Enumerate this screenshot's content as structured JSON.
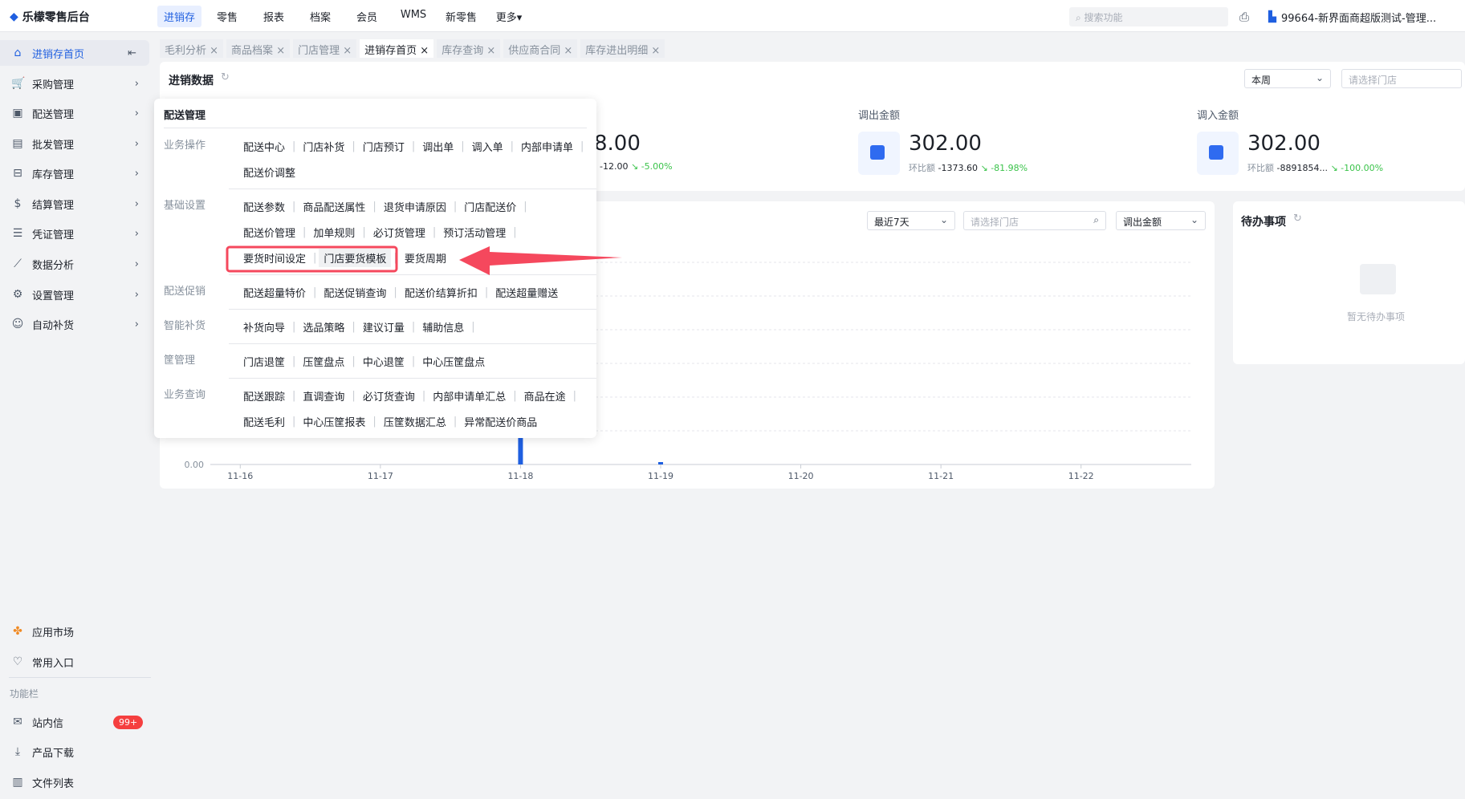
{
  "app": {
    "title": "乐檬零售后台"
  },
  "topnav": {
    "items": [
      "进销存",
      "零售",
      "报表",
      "档案",
      "会员",
      "WMS",
      "新零售",
      "更多▾"
    ],
    "active": 0,
    "search_placeholder": "搜索功能",
    "user": "99664-新界面商超版测试-管理..."
  },
  "sidebar": {
    "items": [
      {
        "label": "进销存首页",
        "icon": "home-icon"
      },
      {
        "label": "采购管理",
        "icon": "cart-icon"
      },
      {
        "label": "配送管理",
        "icon": "box-icon"
      },
      {
        "label": "批发管理",
        "icon": "storage-icon"
      },
      {
        "label": "库存管理",
        "icon": "inventory-icon"
      },
      {
        "label": "结算管理",
        "icon": "dollar-icon"
      },
      {
        "label": "凭证管理",
        "icon": "document-icon"
      },
      {
        "label": "数据分析",
        "icon": "chart-icon"
      },
      {
        "label": "设置管理",
        "icon": "gear-icon"
      },
      {
        "label": "自动补货",
        "icon": "robot-icon"
      }
    ],
    "bottom": [
      {
        "label": "应用市场",
        "icon": "app-market-icon"
      },
      {
        "label": "常用入口",
        "icon": "heart-icon"
      }
    ],
    "section": "功能栏",
    "tools": [
      {
        "label": "站内信",
        "icon": "mail-icon",
        "badge": "99+"
      },
      {
        "label": "产品下载",
        "icon": "download-icon"
      },
      {
        "label": "文件列表",
        "icon": "file-list-icon"
      }
    ]
  },
  "tabs": [
    "毛利分析",
    "商品档案",
    "门店管理",
    "进销存首页",
    "库存查询",
    "供应商合同",
    "库存进出明细"
  ],
  "active_tab": 3,
  "overview": {
    "title": "进销数据",
    "period": "本周",
    "store_placeholder": "请选择门店",
    "cards": [
      {
        "label": "",
        "value": "8.00",
        "compare": "-12.00",
        "pct": "-5.00%"
      },
      {
        "label": "调出金额",
        "value": "302.00",
        "compare_label": "环比额",
        "compare": "-1373.60",
        "pct": "-81.98%"
      },
      {
        "label": "调入金额",
        "value": "302.00",
        "compare_label": "环比额",
        "compare": "-8891854...",
        "pct": "-100.00%"
      }
    ]
  },
  "chart_panel": {
    "range": "最近7天",
    "store_placeholder": "请选择门店",
    "metric": "调出金额"
  },
  "chart_data": {
    "type": "bar",
    "categories": [
      "11-16",
      "11-17",
      "11-18",
      "11-19",
      "11-20",
      "11-21",
      "11-22"
    ],
    "values": [
      0,
      0,
      302,
      2,
      0,
      0,
      0
    ],
    "ytick_visible": "0.00",
    "color": "#1f5fe0"
  },
  "todo": {
    "title": "待办事项",
    "empty": "暂无待办事项"
  },
  "menu": {
    "title": "配送管理",
    "groups": [
      {
        "label": "业务操作",
        "rows": [
          [
            "配送中心",
            "门店补货",
            "门店预订",
            "调出单",
            "调入单",
            "内部申请单"
          ],
          [
            "配送价调整"
          ]
        ]
      },
      {
        "label": "基础设置",
        "rows": [
          [
            "配送参数",
            "商品配送属性",
            "退货申请原因",
            "门店配送价"
          ],
          [
            "配送价管理",
            "加单规则",
            "必订货管理",
            "预订活动管理"
          ],
          [
            "要货时间设定",
            "门店要货模板",
            "要货周期"
          ]
        ]
      },
      {
        "label": "配送促销",
        "rows": [
          [
            "配送超量特价",
            "配送促销查询",
            "配送价结算折扣",
            "配送超量赠送"
          ]
        ]
      },
      {
        "label": "智能补货",
        "rows": [
          [
            "补货向导",
            "选品策略",
            "建议订量",
            "辅助信息"
          ]
        ]
      },
      {
        "label": "筐管理",
        "rows": [
          [
            "门店退筐",
            "压筐盘点",
            "中心退筐",
            "中心压筐盘点"
          ]
        ]
      },
      {
        "label": "业务查询",
        "rows": [
          [
            "配送跟踪",
            "直调查询",
            "必订货查询",
            "内部申请单汇总",
            "商品在途"
          ],
          [
            "配送毛利",
            "中心压筐报表",
            "压筐数据汇总",
            "异常配送价商品"
          ]
        ]
      }
    ]
  },
  "annotation": {
    "highlight_color": "#f5485d"
  }
}
